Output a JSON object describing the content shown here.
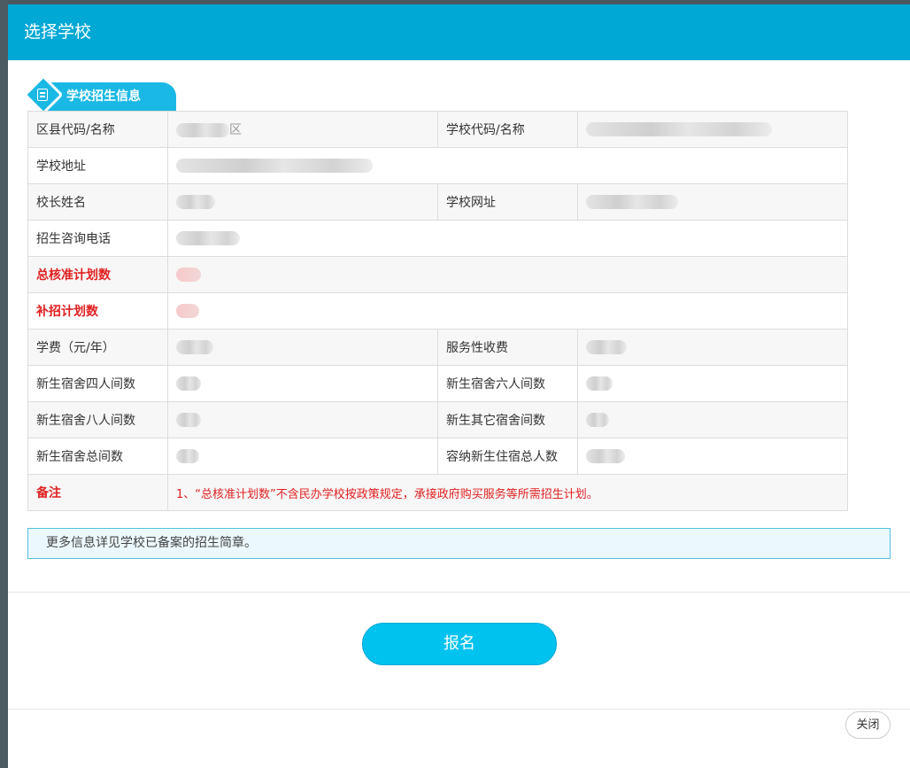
{
  "dialog": {
    "title": "选择学校",
    "section_title": "学校招生信息",
    "table": {
      "district_label": "区县代码/名称",
      "district_value_suffix": "区",
      "school_code_label": "学校代码/名称",
      "address_label": "学校地址",
      "principal_label": "校长姓名",
      "website_label": "学校网址",
      "phone_label": "招生咨询电话",
      "total_plan_label": "总核准计划数",
      "supplement_plan_label": "补招计划数",
      "tuition_label": "学费（元/年）",
      "service_fee_label": "服务性收费",
      "dorm4_label": "新生宿舍四人间数",
      "dorm6_label": "新生宿舍六人间数",
      "dorm8_label": "新生宿舍八人间数",
      "dorm_other_label": "新生其它宿舍间数",
      "dorm_total_label": "新生宿舍总间数",
      "capacity_label": "容纳新生住宿总人数",
      "remark_label": "备注",
      "remark_value": "1、“总核准计划数”不含民办学校按政策规定，承接政府购买服务等所需招生计划。"
    },
    "notice": "更多信息详见学校已备案的招生简章。",
    "signup_button": "报名",
    "close_button": "关闭"
  },
  "colors": {
    "header": "#00a8d5",
    "accent_red": "#e02020",
    "button": "#00c2ee"
  }
}
